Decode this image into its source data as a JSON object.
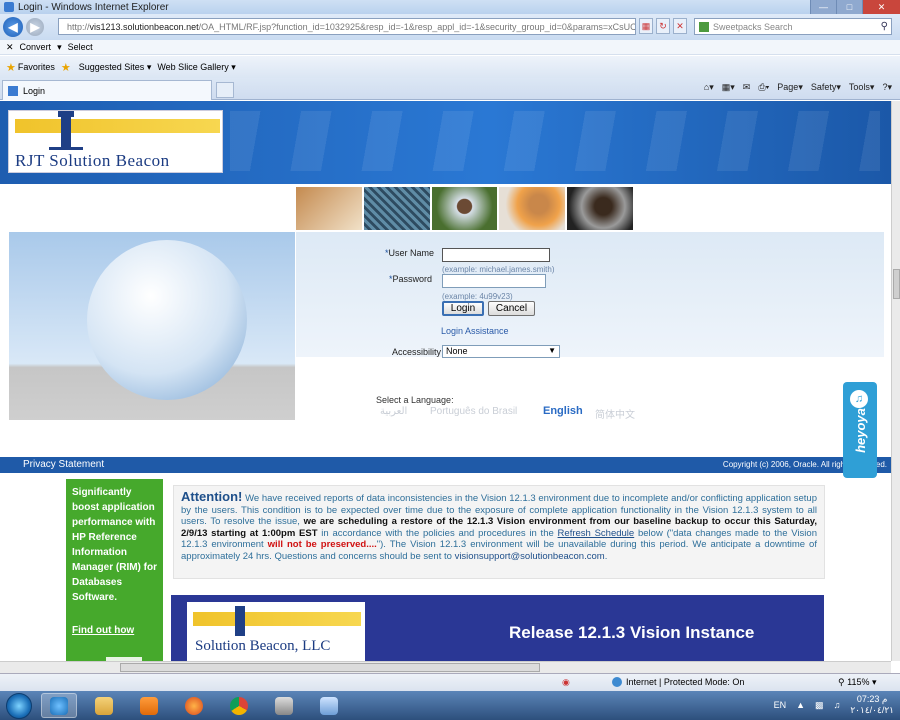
{
  "window": {
    "title": "Login - Windows Internet Explorer",
    "url_prefix": "http://",
    "url_host": "vis1213.solutionbeacon.net",
    "url_path": "/OA_HTML/RF.jsp?function_id=1032925&resp_id=-1&resp_appl_id=-1&security_group_id=0&params=xCsUChill",
    "search_placeholder": "Sweetpacks Search"
  },
  "commandbar": {
    "convert": "Convert",
    "select": "Select"
  },
  "favorites": {
    "favorites": "Favorites",
    "suggested": "Suggested Sites",
    "webslice": "Web Slice Gallery"
  },
  "tab": {
    "label": "Login"
  },
  "toolbar": {
    "page": "Page",
    "safety": "Safety",
    "tools": "Tools",
    "help": "?"
  },
  "logo": {
    "name": "RJT Solution Beacon"
  },
  "login": {
    "username_label": "User Name",
    "username_value": "",
    "username_hint": "(example: michael.james.smith)",
    "password_label": "Password",
    "password_value": "",
    "password_hint": "(example: 4u99v23)",
    "login_button": "Login",
    "cancel_button": "Cancel",
    "assistance_link": "Login Assistance",
    "accessibility_label": "Accessibility",
    "accessibility_value": "None",
    "required_mark": "*"
  },
  "language": {
    "title": "Select a Language:",
    "options": [
      "العربية",
      "Português do Brasil",
      "English",
      "简体中文"
    ],
    "selected": "English"
  },
  "footer": {
    "privacy": "Privacy Statement",
    "copyright": "Copyright (c) 2006, Oracle. All rights reserved."
  },
  "heyoya": {
    "label": "heyoya"
  },
  "ad": {
    "text": "Significantly boost application performance with HP Reference Information Manager (RIM) for Databases Software.",
    "cta": "Find out how"
  },
  "attention": {
    "heading": "Attention!",
    "p1": " We have received reports of data inconsistencies in the Vision 12.1.3 environment due to incomplete and/or conflicting application setup by the users. This condition is to be expected over time due to the exposure of complete application functionality in the Vision 12.1.3 system to all users. To resolve the issue, ",
    "bold1": "we are scheduling a restore of the 12.1.3 Vision environment from our baseline backup to occur this Saturday, 2/9/13 starting at 1:00pm EST",
    "p2": " in accordance with the policies and procedures in the ",
    "link": "Refresh Schedule",
    "p3": " below (\"data changes made to the Vision 12.1.3 environment ",
    "red": "will not be preserved....",
    "p4": "\"). The Vision 12.1.3 environment will be unavailable during this period. We anticipate a downtime of approximately 24 hrs. Questions and concerns should be sent to ",
    "email": "visionsupport@solutionbeacon.com",
    "end": "."
  },
  "release": {
    "logo": "Solution Beacon, LLC",
    "title": "Release 12.1.3 Vision Instance"
  },
  "status": {
    "zone": "Internet | Protected Mode: On",
    "zoom": "115%"
  },
  "taskbar": {
    "lang": "EN",
    "time": "07:23 م",
    "date": "٢٠١٤/٠٤/٢١"
  },
  "colors": {
    "banner": "#2a78d4",
    "footer": "#1f5aa8",
    "ad_green": "#46a92c",
    "release_bg": "#2a3795",
    "heyoya": "#2f9fd6"
  }
}
